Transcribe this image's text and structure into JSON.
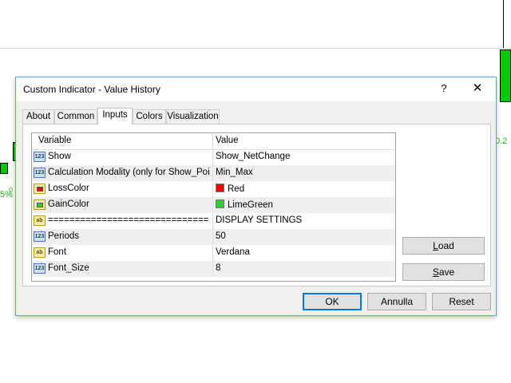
{
  "background": {
    "chart_label_left": "5%",
    "chart_label_left_small": "0",
    "chart_label_right": "0.2"
  },
  "dialog": {
    "title": "Custom Indicator - Value History",
    "help_symbol": "?",
    "close_symbol": "✕",
    "tabs": [
      {
        "label": "About"
      },
      {
        "label": "Common"
      },
      {
        "label": "Inputs"
      },
      {
        "label": "Colors"
      },
      {
        "label": "Visualization"
      }
    ],
    "active_tab": "Inputs",
    "grid": {
      "headers": {
        "variable": "Variable",
        "value": "Value"
      },
      "rows": [
        {
          "type_icon": "123",
          "variable": "Show",
          "value": "Show_NetChange"
        },
        {
          "type_icon": "123",
          "variable": "Calculation Modality (only for Show_Poin...",
          "value": "Min_Max"
        },
        {
          "type_icon": "color",
          "variable": "LossColor",
          "value": "Red",
          "color": "#ff0000"
        },
        {
          "type_icon": "color",
          "variable": "GainColor",
          "value": "LimeGreen",
          "color": "#32cd32"
        },
        {
          "type_icon": "ab",
          "variable": "================================",
          "value": "DISPLAY SETTINGS"
        },
        {
          "type_icon": "123",
          "variable": "Periods",
          "value": "50"
        },
        {
          "type_icon": "ab",
          "variable": "Font",
          "value": "Verdana"
        },
        {
          "type_icon": "123",
          "variable": "Font_Size",
          "value": "8"
        }
      ]
    },
    "buttons": {
      "load": "Load",
      "save": "Save",
      "ok": "OK",
      "cancel": "Annulla",
      "reset": "Reset"
    }
  }
}
